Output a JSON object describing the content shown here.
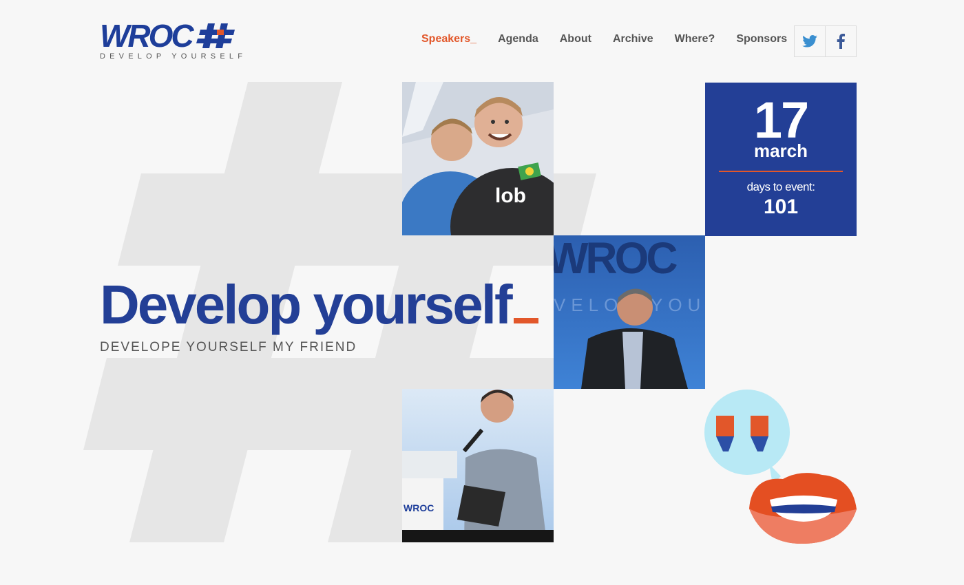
{
  "logo": {
    "wordmark": "WROC",
    "tagline": "DEVELOP YOURSELF"
  },
  "nav": {
    "items": [
      {
        "label": "Speakers_",
        "active": true
      },
      {
        "label": "Agenda",
        "active": false
      },
      {
        "label": "About",
        "active": false
      },
      {
        "label": "Archive",
        "active": false
      },
      {
        "label": "Where?",
        "active": false
      },
      {
        "label": "Sponsors",
        "active": false
      }
    ]
  },
  "social": {
    "twitter_icon": "twitter-icon",
    "facebook_icon": "facebook-icon"
  },
  "event": {
    "day": "17",
    "month": "march",
    "countdown_label": "days to event:",
    "countdown_value": "101"
  },
  "hero": {
    "title": "Develop yourself",
    "subtitle": "DEVELOPE YOURSELF MY FRIEND"
  },
  "photos": {
    "photo1_alt": "two speakers smiling",
    "photo2_alt": "speaker on stage",
    "photo3_alt": "speaker with microphone"
  },
  "colors": {
    "brand_blue": "#233f96",
    "accent_orange": "#e2572a",
    "background": "#f7f7f7"
  }
}
